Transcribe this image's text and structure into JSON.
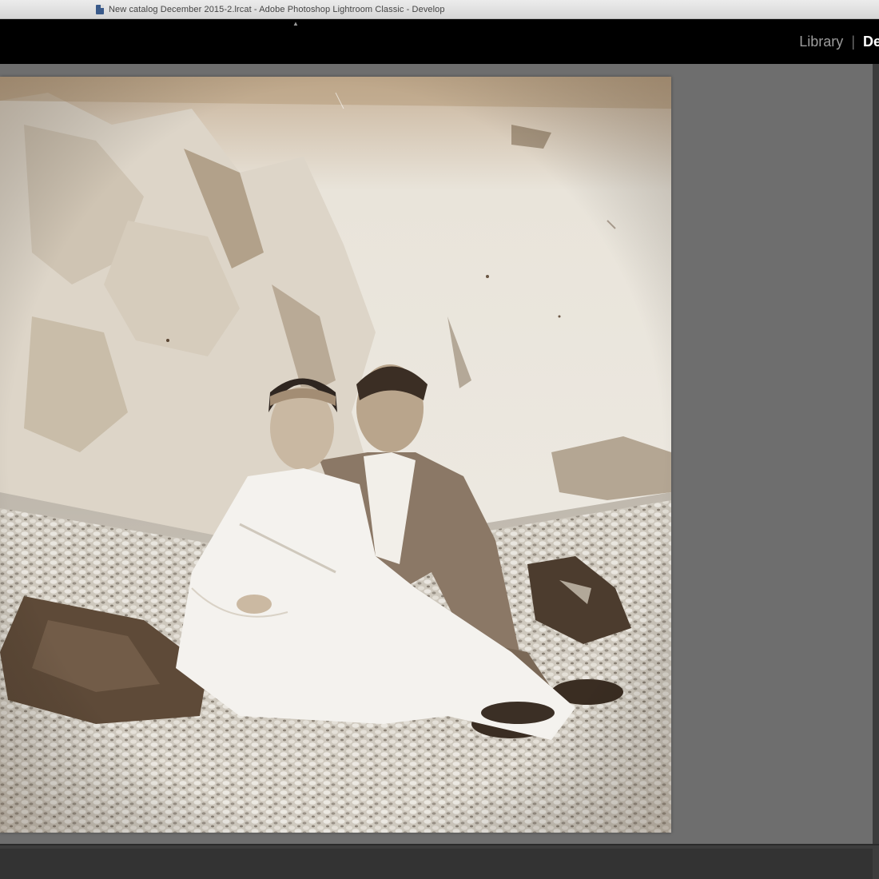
{
  "window": {
    "title": "New catalog December 2015-2.lrcat - Adobe Photoshop Lightroom Classic - Develop",
    "doc_icon": "lrcat-document-icon"
  },
  "top_panel_toggle": {
    "icon": "triangle-up-icon",
    "glyph": "▲"
  },
  "module_picker": {
    "items": [
      {
        "label": "Library",
        "active": false
      },
      {
        "label": "Develop",
        "active": true
      }
    ],
    "separator": "|"
  },
  "colors": {
    "module_bar": "#000000",
    "workspace": "#6e6e6e",
    "module_active": "#ffffff",
    "module_inactive": "#9c9c9c",
    "photo_tone": "#ebe6dc",
    "sepia_shadow": "#6a5644"
  },
  "photo": {
    "description_icon": "sepia-photograph"
  }
}
